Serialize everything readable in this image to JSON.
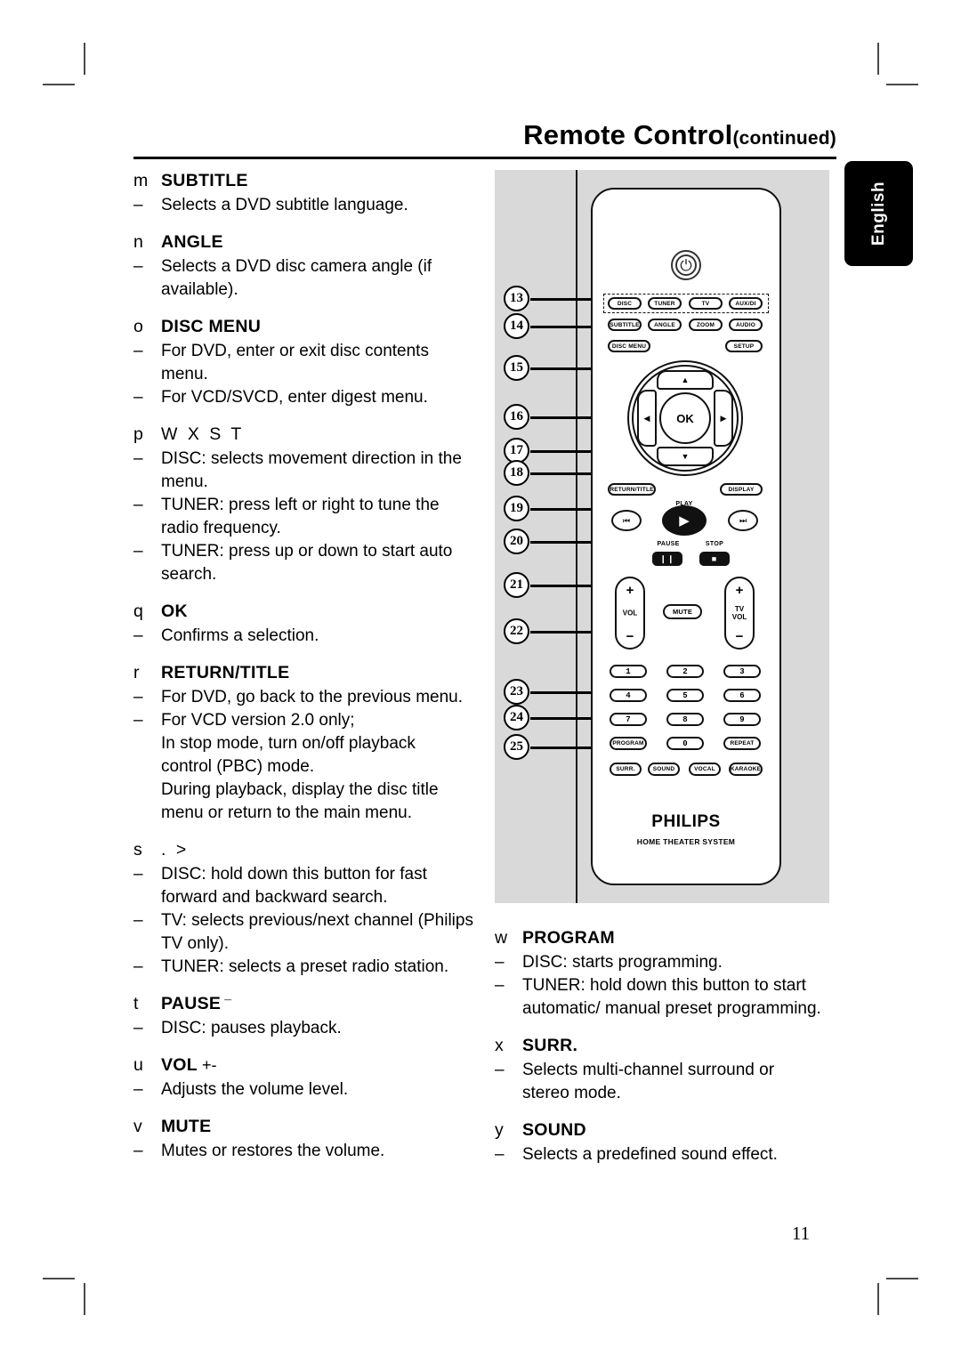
{
  "header": {
    "title": "Remote Control",
    "continued": "(continued)"
  },
  "language_tab": "English",
  "page_number": "11",
  "left_column": [
    {
      "key": "m",
      "title": "SUBTITLE",
      "bullets": [
        [
          "Selects a DVD subtitle language."
        ]
      ]
    },
    {
      "key": "n",
      "title": "ANGLE",
      "bullets": [
        [
          "Selects a DVD disc camera angle (if",
          "available)."
        ]
      ]
    },
    {
      "key": "o",
      "title": "DISC MENU",
      "bullets": [
        [
          "For DVD, enter or exit disc contents",
          "menu."
        ],
        [
          "For VCD/SVCD, enter digest menu."
        ]
      ]
    },
    {
      "key": "p",
      "title": "W X S T",
      "symbol": true,
      "bullets": [
        [
          "DISC: selects movement direction in the",
          "menu."
        ],
        [
          "TUNER: press left or right to tune the",
          "radio frequency."
        ],
        [
          "TUNER: press up or down to start auto",
          "search."
        ]
      ]
    },
    {
      "key": "q",
      "title": "OK",
      "bullets": [
        [
          "Confirms a selection."
        ]
      ]
    },
    {
      "key": "r",
      "title": "RETURN/TITLE",
      "bullets": [
        [
          "For DVD, go back to the previous menu."
        ],
        [
          "For VCD version 2.0 only;",
          "In stop mode, turn on/off playback",
          "control (PBC) mode.",
          "During playback, display the disc title",
          "menu or return to the main menu."
        ]
      ]
    },
    {
      "key": "s",
      "title": ".     >",
      "symbol": true,
      "bullets": [
        [
          "DISC: hold down this button for fast",
          "forward and backward search."
        ],
        [
          "TV: selects previous/next channel (Philips",
          "TV only)."
        ],
        [
          "TUNER:  selects a preset radio station."
        ]
      ]
    },
    {
      "key": "t",
      "title": "PAUSE",
      "superscript": "¯",
      "bullets": [
        [
          "DISC: pauses playback."
        ]
      ]
    },
    {
      "key": "u",
      "title": "VOL",
      "suffix": "+-",
      "bullets": [
        [
          "Adjusts the volume level."
        ]
      ]
    },
    {
      "key": "v",
      "title": "MUTE",
      "bullets": [
        [
          "Mutes or restores the volume."
        ]
      ]
    }
  ],
  "right_column": [
    {
      "key": "w",
      "title": "PROGRAM",
      "bullets": [
        [
          "DISC: starts programming."
        ],
        [
          "TUNER: hold down this button to start",
          "automatic/ manual preset programming."
        ]
      ]
    },
    {
      "key": "x",
      "title": "SURR.",
      "bullets": [
        [
          "Selects multi-channel surround or",
          "stereo mode."
        ]
      ]
    },
    {
      "key": "y",
      "title": "SOUND",
      "bullets": [
        [
          "Selects a predefined sound effect."
        ]
      ]
    }
  ],
  "illustration": {
    "callout_numbers": [
      "13",
      "14",
      "15",
      "16",
      "17",
      "18",
      "19",
      "20",
      "21",
      "22",
      "23",
      "24",
      "25"
    ],
    "source_keys": [
      "DISC",
      "TUNER",
      "TV",
      "AUX/DI"
    ],
    "function_keys": [
      "SUBTITLE",
      "ANGLE",
      "ZOOM",
      "AUDIO"
    ],
    "menu_keys": [
      "DISC MENU",
      "SETUP"
    ],
    "ok_label": "OK",
    "nav_keys": [
      "RETURN/TITLE",
      "DISPLAY"
    ],
    "play_label": "PLAY",
    "pause_label": "PAUSE",
    "stop_label": "STOP",
    "vol_label": "VOL",
    "tv_vol_label": "TV\nVOL",
    "mute_label": "MUTE",
    "plus": "+",
    "minus": "−",
    "numeric_keys": [
      "1",
      "2",
      "3",
      "4",
      "5",
      "6",
      "7",
      "8",
      "9",
      "0"
    ],
    "program_label": "PROGRAM",
    "repeat_label": "REPEAT",
    "mode_keys": [
      "SURR.",
      "SOUND",
      "VOCAL",
      "KARAOKE"
    ],
    "brand": "PHILIPS",
    "brand_sub": "HOME THEATER SYSTEM"
  },
  "colors": {
    "panel_gray": "#d9d9d9",
    "ink": "#000000",
    "tab_bg": "#000000"
  }
}
